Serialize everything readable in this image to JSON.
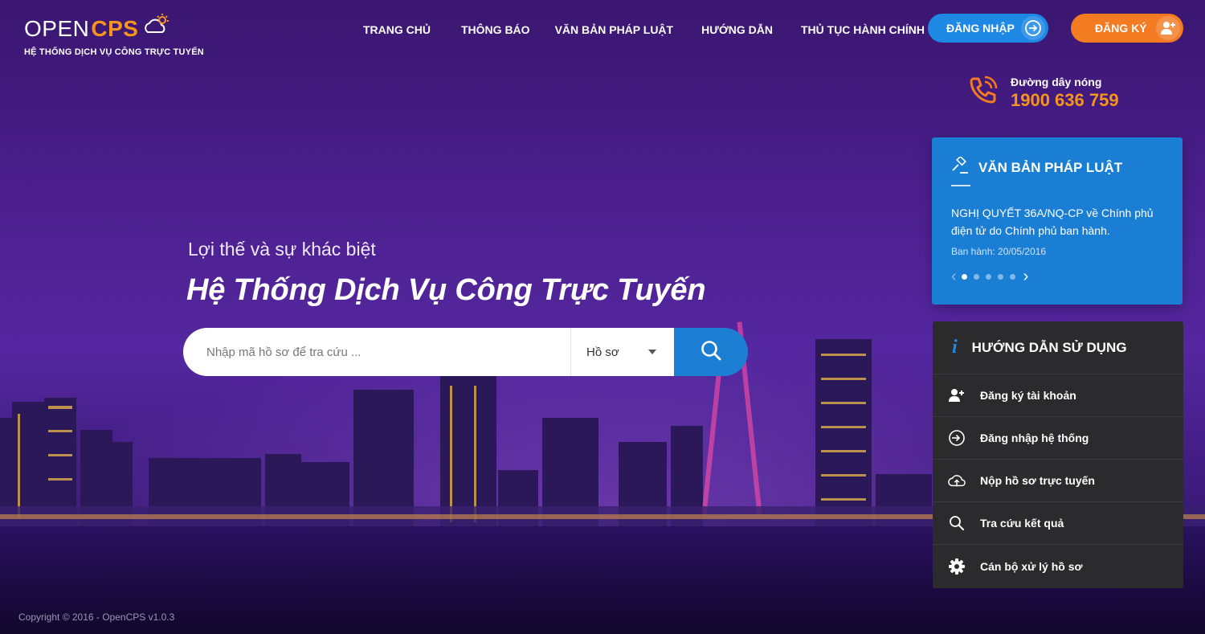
{
  "brand": {
    "logo_open": "OPEN",
    "logo_cps": "CPS",
    "subtitle": "HỆ THỐNG DỊCH VỤ CÔNG TRỰC TUYẾN"
  },
  "nav": {
    "items": [
      {
        "label": "TRANG CHỦ"
      },
      {
        "label": "THÔNG BÁO"
      },
      {
        "label": "VĂN BẢN PHÁP LUẬT"
      },
      {
        "label": "HƯỚNG DẪN"
      },
      {
        "label": "THỦ TỤC HÀNH CHÍNH"
      }
    ],
    "login_label": "ĐĂNG NHẬP",
    "register_label": "ĐĂNG KÝ"
  },
  "hotline": {
    "label": "Đường dây nóng",
    "number": "1900 636 759"
  },
  "hero": {
    "tagline": "Lợi thế và sự khác biệt",
    "title": "Hệ Thống Dịch Vụ Công Trực Tuyến"
  },
  "search": {
    "placeholder": "Nhập mã hồ sơ để tra cứu ...",
    "value": "",
    "selected_option": "Hồ sơ"
  },
  "legal_docs": {
    "title": "VĂN BẢN PHÁP LUẬT",
    "current_text": "NGHỊ QUYẾT 36A/NQ-CP về Chính phủ điện tử do Chính phủ ban hành.",
    "current_date": "Ban hành: 20/05/2016",
    "slide_count": 5,
    "active_slide": 1
  },
  "guide": {
    "title": "HƯỚNG DẪN SỬ DỤNG",
    "items": [
      {
        "label": "Đăng ký tài khoản",
        "icon": "add-user-icon"
      },
      {
        "label": "Đăng nhập hệ thống",
        "icon": "login-icon"
      },
      {
        "label": "Nộp hồ sơ trực tuyến",
        "icon": "cloud-upload-icon"
      },
      {
        "label": "Tra cứu kết quả",
        "icon": "search-icon"
      },
      {
        "label": "Cán bộ xử lý hồ sơ",
        "icon": "gear-icon"
      }
    ]
  },
  "footer": {
    "copyright": "Copyright © 2016 - OpenCPS v1.0.3"
  },
  "colors": {
    "accent_blue": "#1e88e5",
    "accent_orange": "#f37b21",
    "panel_dark": "#2b2b2e"
  }
}
